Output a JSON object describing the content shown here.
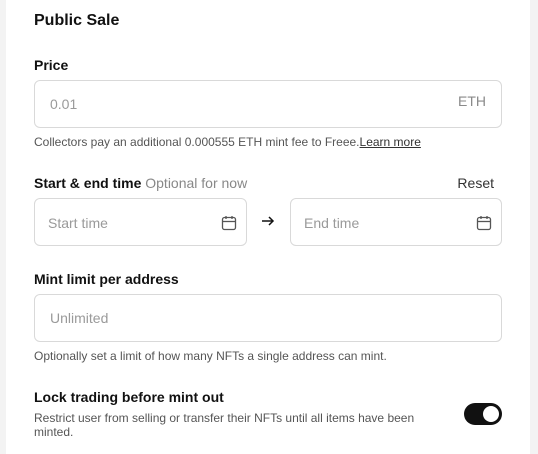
{
  "section": {
    "title": "Public Sale"
  },
  "price": {
    "label": "Price",
    "placeholder": "0.01",
    "suffix": "ETH",
    "help_text": "Collectors pay an additional 0.000555 ETH mint fee to Freee.",
    "learn_more": "Learn more"
  },
  "schedule": {
    "label": "Start & end time",
    "optional_note": "Optional for now",
    "reset_label": "Reset",
    "start_placeholder": "Start time",
    "end_placeholder": "End time",
    "arrow": "→"
  },
  "mint_limit": {
    "label": "Mint limit per address",
    "placeholder": "Unlimited",
    "help_text": "Optionally set a limit of how many NFTs a single address can mint."
  },
  "lock_trading": {
    "label": "Lock trading before mint out",
    "description": "Restrict user from selling or transfer their NFTs until all items have been minted.",
    "enabled": true
  },
  "icons": {
    "calendar": "calendar-icon",
    "arrow": "arrow-right-icon"
  }
}
